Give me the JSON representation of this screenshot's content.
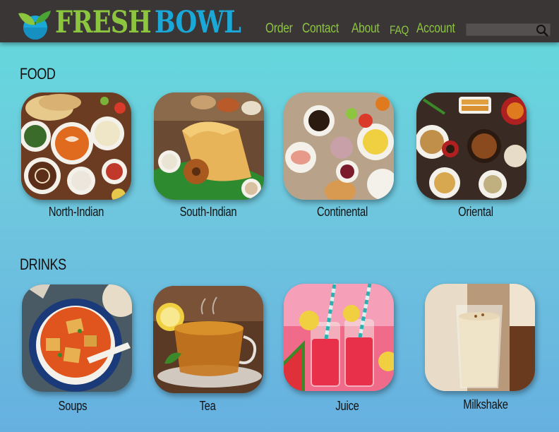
{
  "brand": {
    "word1": "FRESH",
    "word2": "BOWL",
    "logo_icon": "leaf-bowl-icon"
  },
  "nav": {
    "order": "Order",
    "contact": "Contact",
    "about": "About",
    "faq": "FAQ",
    "account": "Account"
  },
  "search": {
    "placeholder": "",
    "value": "",
    "icon": "search-icon"
  },
  "sections": {
    "food": {
      "title": "FOOD",
      "items": [
        {
          "label": "North-Indian",
          "image": "north-indian-thali-image"
        },
        {
          "label": "South-Indian",
          "image": "dosa-vada-image"
        },
        {
          "label": "Continental",
          "image": "continental-breakfast-image"
        },
        {
          "label": "Oriental",
          "image": "oriental-noodles-image"
        }
      ]
    },
    "drinks": {
      "title": "DRINKS",
      "items": [
        {
          "label": "Soups",
          "image": "tomato-soup-image"
        },
        {
          "label": "Tea",
          "image": "tea-cup-image"
        },
        {
          "label": "Juice",
          "image": "watermelon-juice-image"
        },
        {
          "label": "Milkshake",
          "image": "milkshake-glass-image"
        }
      ]
    }
  },
  "colors": {
    "nav_bg": "#3a3636",
    "accent_green": "#8cc63f",
    "accent_blue": "#1aa8d8"
  }
}
